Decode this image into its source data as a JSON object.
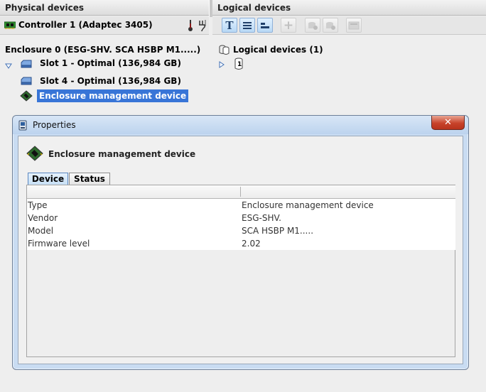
{
  "left_panel": {
    "title": "Physical devices",
    "controller_label": "Controller 1 (Adaptec 3405)",
    "enclosure_label": "Enclosure 0 (ESG-SHV. SCA HSBP M1.....)",
    "items": [
      {
        "label": "Slot 1 - Optimal (136,984 GB)",
        "icon": "hard-disk-icon"
      },
      {
        "label": "Slot 4 - Optimal (136,984 GB)",
        "icon": "hard-disk-icon"
      },
      {
        "label": "Enclosure management device",
        "icon": "chip-icon",
        "selected": true
      }
    ]
  },
  "right_panel": {
    "title": "Logical devices",
    "root_label": "Logical devices (1)",
    "child_badge": "1"
  },
  "dialog": {
    "title": "Properties",
    "device_title": "Enclosure management device",
    "close_symbol": "✕",
    "tabs": [
      {
        "label": "Device",
        "active": true
      },
      {
        "label": "Status",
        "active": false
      }
    ],
    "rows": [
      {
        "key": "Type",
        "value": "Enclosure management device"
      },
      {
        "key": "Vendor",
        "value": "ESG-SHV."
      },
      {
        "key": "Model",
        "value": "SCA HSBP M1....."
      },
      {
        "key": "Firmware level",
        "value": "2.02"
      }
    ]
  },
  "toolbar": {
    "text_view_symbol": "T"
  },
  "colors": {
    "selection": "#3875d7",
    "accent_blue": "#8fb1d9"
  }
}
